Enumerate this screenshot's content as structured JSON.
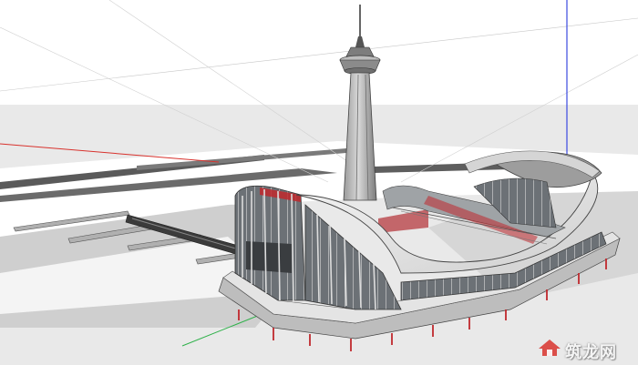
{
  "watermark": {
    "text": "筑龙网",
    "icon": "house-logo-icon",
    "color": "#ffffff"
  },
  "colors": {
    "sky": "#ffffff",
    "ground": "#e9e9e9",
    "shadow": "#cfcfcf",
    "structure": "#8f8f8f",
    "glass": "#555a5f",
    "accent_red": "#c0282d",
    "axis_blue": "#3b49e0",
    "axis_green": "#2fb14a",
    "axis_red": "#d8322d"
  }
}
